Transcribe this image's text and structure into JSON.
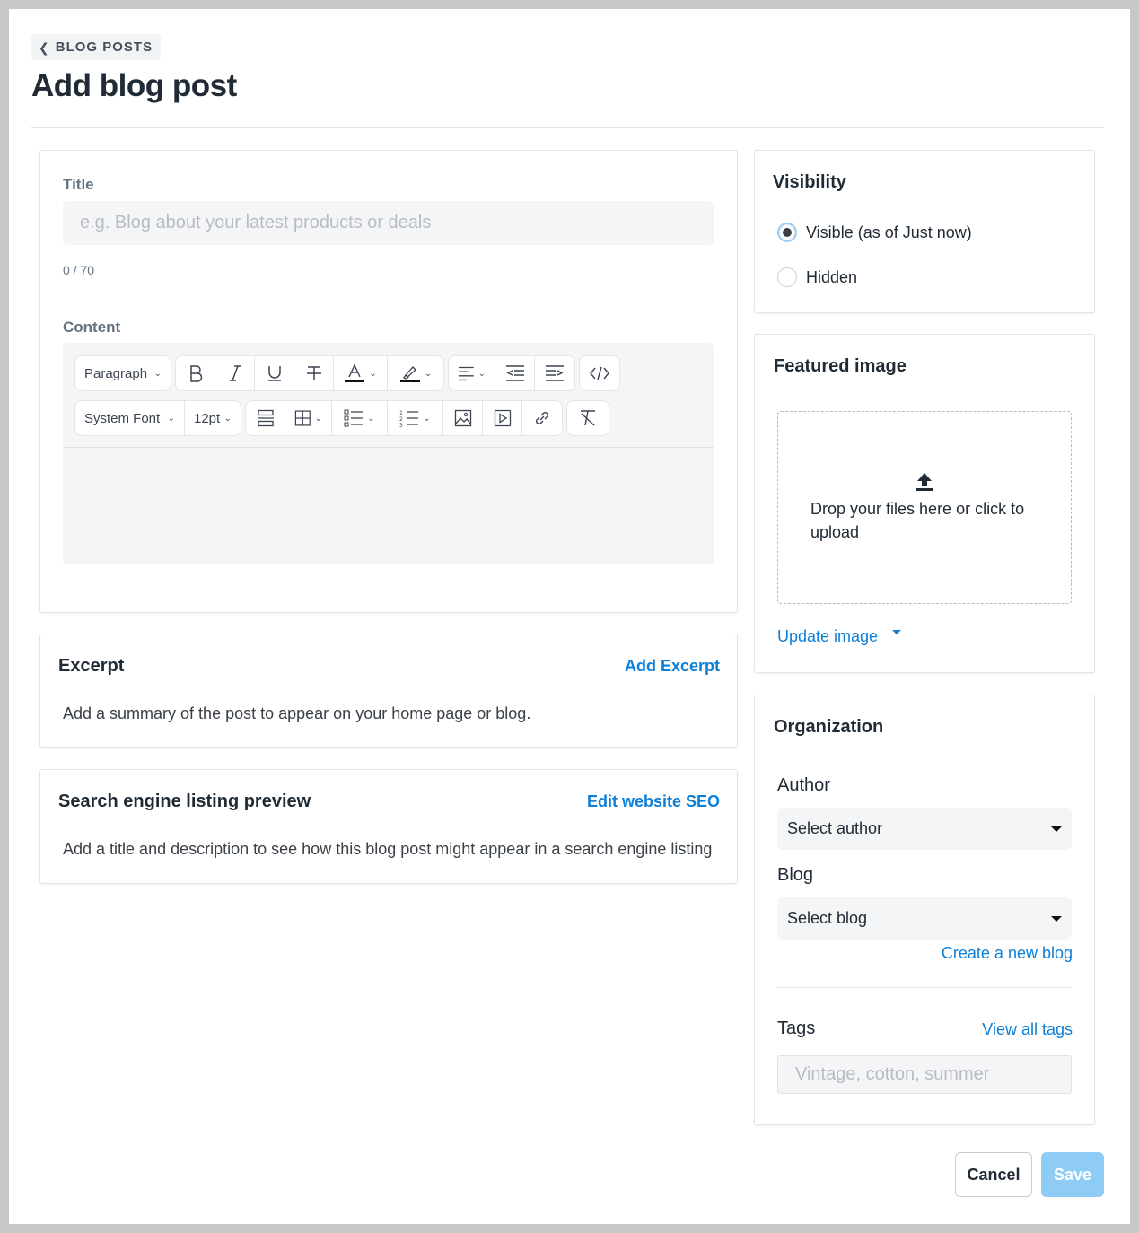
{
  "header": {
    "back_label": "BLOG POSTS",
    "title": "Add blog post"
  },
  "main": {
    "title_label": "Title",
    "title_placeholder": "e.g. Blog about your latest products or deals",
    "title_value": "",
    "title_count": "0 / 70",
    "content_label": "Content",
    "toolbar": {
      "block_format": "Paragraph",
      "font_family": "System Font",
      "font_size": "12pt",
      "icons_row1": [
        "bold-icon",
        "italic-icon",
        "underline-icon",
        "strikethrough-icon",
        "text-color-icon",
        "highlight-color-icon",
        "align-icon",
        "outdent-icon",
        "indent-icon",
        "source-code-icon"
      ],
      "icons_row2": [
        "horizontal-rule-icon",
        "table-icon",
        "bullet-list-icon",
        "numbered-list-icon",
        "insert-image-icon",
        "insert-video-icon",
        "insert-link-icon",
        "clear-formatting-icon"
      ]
    },
    "excerpt": {
      "heading": "Excerpt",
      "action": "Add Excerpt",
      "description": "Add a summary of the post to appear on your home page or blog."
    },
    "seo": {
      "heading": "Search engine listing preview",
      "action": "Edit website SEO",
      "description": "Add a title and description to see how this blog post might appear in a search engine listing"
    }
  },
  "sidebar": {
    "visibility": {
      "heading": "Visibility",
      "options": [
        {
          "label": "Visible (as of Just now)",
          "checked": true
        },
        {
          "label": "Hidden",
          "checked": false
        }
      ]
    },
    "featured_image": {
      "heading": "Featured image",
      "dropzone_text": "Drop your files here or click to upload",
      "update_label": "Update image"
    },
    "organization": {
      "heading": "Organization",
      "author_label": "Author",
      "author_value": "Select author",
      "blog_label": "Blog",
      "blog_value": "Select blog",
      "create_blog_label": "Create a new blog",
      "tags_label": "Tags",
      "view_tags_label": "View all tags",
      "tags_placeholder": "Vintage, cotton, summer"
    }
  },
  "footer": {
    "cancel_label": "Cancel",
    "save_label": "Save"
  },
  "colors": {
    "accent": "#0c7fd8",
    "save_disabled": "#8ecbf5",
    "input_bg": "#f4f5f7"
  }
}
